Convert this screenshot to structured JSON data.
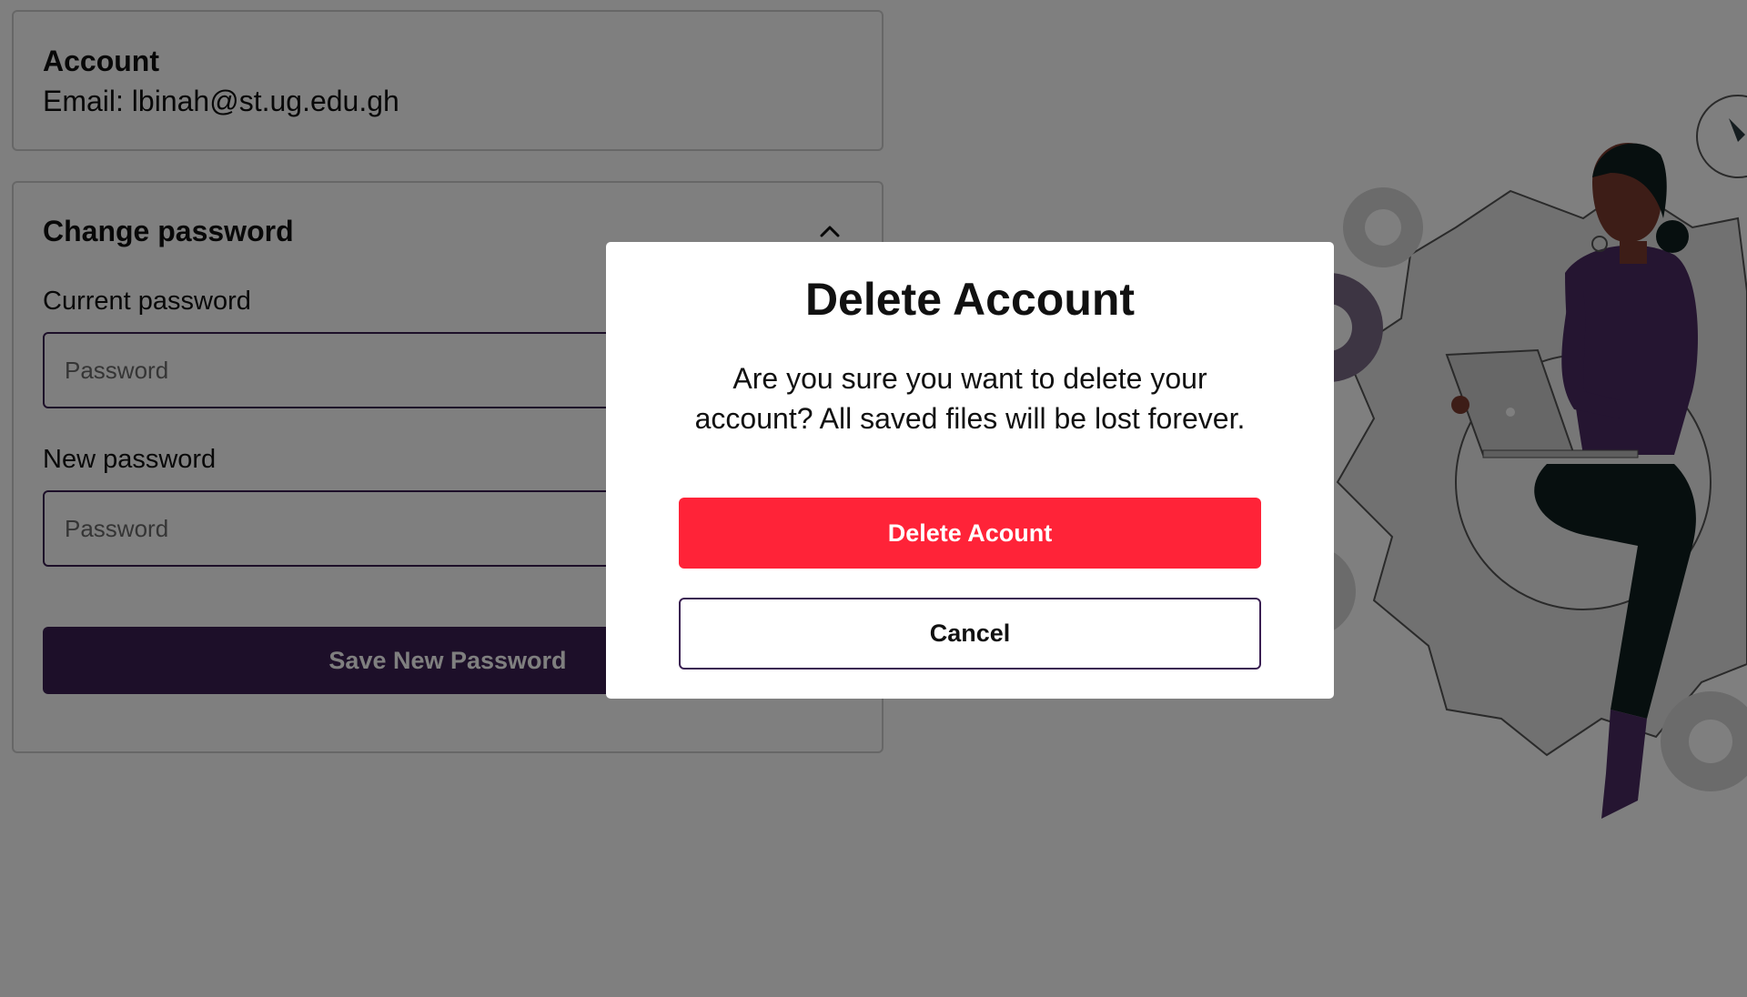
{
  "account": {
    "title": "Account",
    "email": "Email: lbinah@st.ug.edu.gh"
  },
  "change_password": {
    "title": "Change password",
    "current_label": "Current password",
    "current_placeholder": "Password",
    "new_label": "New password",
    "new_placeholder": "Password",
    "save_label": "Save New Password"
  },
  "icons": {
    "collapse": "chevron-up-icon",
    "illustration": "person-with-laptop-and-gears"
  },
  "modal": {
    "title": "Delete Account",
    "message": "Are you sure you want to delete your account? All saved files will be lost forever.",
    "delete_label": "Delete Acount",
    "cancel_label": "Cancel"
  },
  "colors": {
    "primary_dark": "#3a1f52",
    "danger": "#ff2338",
    "overlay": "rgba(0,0,0,0.5)"
  }
}
